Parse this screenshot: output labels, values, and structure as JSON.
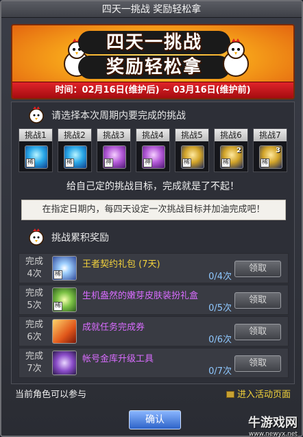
{
  "window": {
    "title": "四天一挑战 奖励轻松拿"
  },
  "banner": {
    "title_line1": "四天一挑战",
    "title_line2": "奖励轻松拿",
    "date_text": "时间：02月16日(维护后) ~ 03月16日(维护前)"
  },
  "select_section": {
    "header": "请选择本次周期内要完成的挑战"
  },
  "challenges": [
    {
      "label": "挑战1",
      "tag": "稀",
      "num": ""
    },
    {
      "label": "挑战2",
      "tag": "稀",
      "num": ""
    },
    {
      "label": "挑战3",
      "tag": "神",
      "num": ""
    },
    {
      "label": "挑战4",
      "tag": "神",
      "num": ""
    },
    {
      "label": "挑战5",
      "tag": "稀",
      "num": ""
    },
    {
      "label": "挑战6",
      "tag": "稀",
      "num": "2"
    },
    {
      "label": "挑战7",
      "tag": "稀",
      "num": "3"
    }
  ],
  "motto": "给自己定的挑战目标，完成就是了不起！",
  "notice": "在指定日期内，每四天设定一次挑战目标并加油完成吧！",
  "reward_section": {
    "header": "挑战累积奖励"
  },
  "rewards": [
    {
      "times_top": "完成",
      "times_bottom": "4次",
      "name": "王者契约礼包 (7天)",
      "progress": "0/4次",
      "button": "领取",
      "color": "#f3d23c",
      "tag": "稀"
    },
    {
      "times_top": "完成",
      "times_bottom": "5次",
      "name": "生机盎然的嫩芽皮肤装扮礼盒",
      "progress": "0/5次",
      "button": "领取",
      "color": "#d96cff",
      "tag": "稀"
    },
    {
      "times_top": "完成",
      "times_bottom": "6次",
      "name": "成就任务完成券",
      "progress": "0/6次",
      "button": "领取",
      "color": "#d96cff",
      "tag": ""
    },
    {
      "times_top": "完成",
      "times_bottom": "7次",
      "name": "帐号金库升级工具",
      "progress": "0/7次",
      "button": "领取",
      "color": "#d96cff",
      "tag": ""
    }
  ],
  "footer": {
    "left_text": "当前角色可以参与",
    "right_text": "进入活动页面",
    "confirm_button": "确认"
  },
  "watermark": {
    "brand": "牛游戏网",
    "url": "www.newyx.net"
  }
}
